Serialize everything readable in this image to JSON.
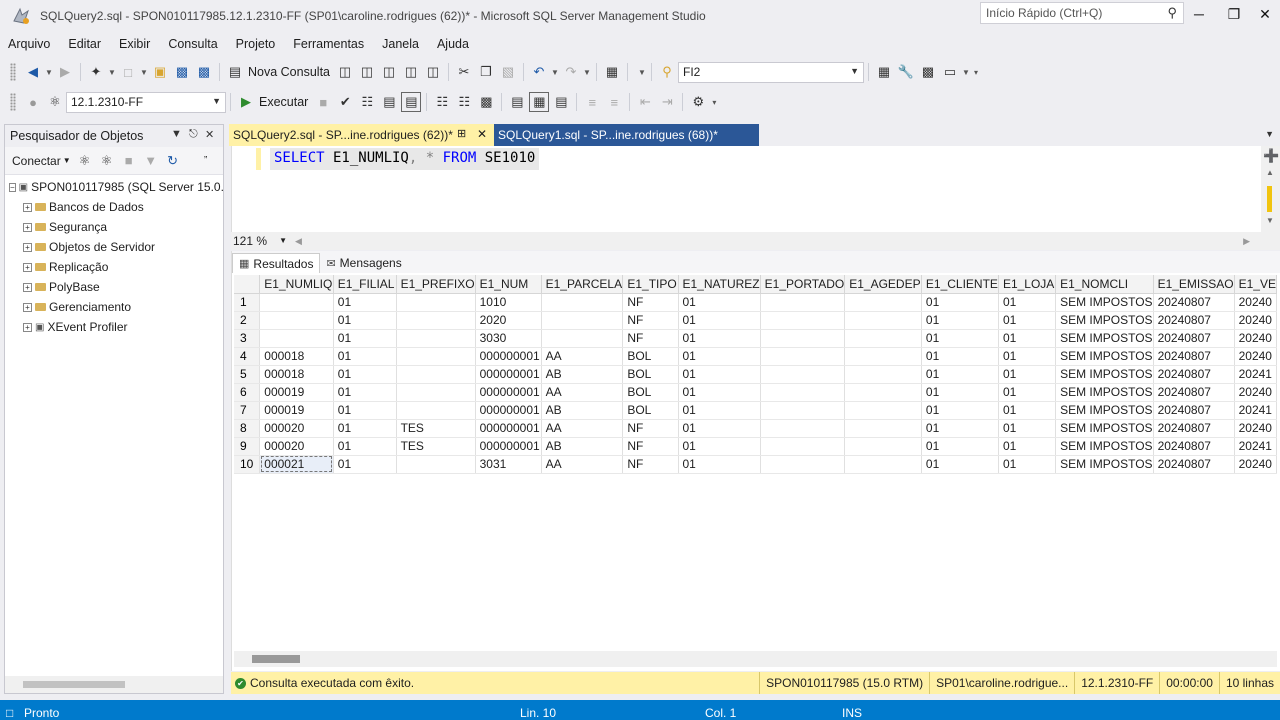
{
  "window": {
    "title": "SQLQuery2.sql - SPON010117985.12.1.2310-FF (SP01\\caroline.rodrigues (62))* - Microsoft SQL Server Management Studio",
    "quick_launch_placeholder": "Início Rápido (Ctrl+Q)"
  },
  "menu": [
    "Arquivo",
    "Editar",
    "Exibir",
    "Consulta",
    "Projeto",
    "Ferramentas",
    "Janela",
    "Ajuda"
  ],
  "toolbar1": {
    "new_query": "Nova Consulta",
    "solution_combo": "FI2"
  },
  "toolbar2": {
    "database_combo": "12.1.2310-FF",
    "execute": "Executar"
  },
  "object_explorer": {
    "title": "Pesquisador de Objetos",
    "connect": "Conectar",
    "server": "SPON010117985 (SQL Server 15.0.",
    "nodes": [
      "Bancos de Dados",
      "Segurança",
      "Objetos de Servidor",
      "Replicação",
      "PolyBase",
      "Gerenciamento",
      "XEvent Profiler"
    ]
  },
  "tabs": {
    "active": "SQLQuery2.sql - SP...ine.rodrigues (62))*",
    "inactive": "SQLQuery1.sql - SP...ine.rodrigues (68))*"
  },
  "editor": {
    "kw1": "SELECT",
    "t1": " E1_NUMLIQ",
    "comma": ",",
    "star": " * ",
    "kw2": "FROM",
    "t2": " SE1010",
    "zoom": "121 %"
  },
  "results": {
    "tab_results": "Resultados",
    "tab_messages": "Mensagens",
    "columns": [
      "",
      "E1_NUMLIQ",
      "E1_FILIAL",
      "E1_PREFIXO",
      "E1_NUM",
      "E1_PARCELA",
      "E1_TIPO",
      "E1_NATUREZ",
      "E1_PORTADO",
      "E1_AGEDEP",
      "E1_CLIENTE",
      "E1_LOJA",
      "E1_NOMCLI",
      "E1_EMISSAO",
      "E1_VE"
    ],
    "rows": [
      [
        "1",
        "",
        "01",
        "",
        "1010",
        "",
        "NF",
        "01",
        "",
        "",
        "01",
        "01",
        "SEM IMPOSTOS",
        "20240807",
        "20240"
      ],
      [
        "2",
        "",
        "01",
        "",
        "2020",
        "",
        "NF",
        "01",
        "",
        "",
        "01",
        "01",
        "SEM IMPOSTOS",
        "20240807",
        "20240"
      ],
      [
        "3",
        "",
        "01",
        "",
        "3030",
        "",
        "NF",
        "01",
        "",
        "",
        "01",
        "01",
        "SEM IMPOSTOS",
        "20240807",
        "20240"
      ],
      [
        "4",
        "000018",
        "01",
        "",
        "000000001",
        "AA",
        "BOL",
        "01",
        "",
        "",
        "01",
        "01",
        "SEM IMPOSTOS",
        "20240807",
        "20240"
      ],
      [
        "5",
        "000018",
        "01",
        "",
        "000000001",
        "AB",
        "BOL",
        "01",
        "",
        "",
        "01",
        "01",
        "SEM IMPOSTOS",
        "20240807",
        "20241"
      ],
      [
        "6",
        "000019",
        "01",
        "",
        "000000001",
        "AA",
        "BOL",
        "01",
        "",
        "",
        "01",
        "01",
        "SEM IMPOSTOS",
        "20240807",
        "20240"
      ],
      [
        "7",
        "000019",
        "01",
        "",
        "000000001",
        "AB",
        "BOL",
        "01",
        "",
        "",
        "01",
        "01",
        "SEM IMPOSTOS",
        "20240807",
        "20241"
      ],
      [
        "8",
        "000020",
        "01",
        "TES",
        "000000001",
        "AA",
        "NF",
        "01",
        "",
        "",
        "01",
        "01",
        "SEM IMPOSTOS",
        "20240807",
        "20240"
      ],
      [
        "9",
        "000020",
        "01",
        "TES",
        "000000001",
        "AB",
        "NF",
        "01",
        "",
        "",
        "01",
        "01",
        "SEM IMPOSTOS",
        "20240807",
        "20241"
      ],
      [
        "10",
        "000021",
        "01",
        "",
        "3031",
        "AA",
        "NF",
        "01",
        "",
        "",
        "01",
        "01",
        "SEM IMPOSTOS",
        "20240807",
        "20240"
      ]
    ]
  },
  "query_status": {
    "message": "Consulta executada com êxito.",
    "server": "SPON010117985 (15.0 RTM)",
    "user": "SP01\\caroline.rodrigue...",
    "database": "12.1.2310-FF",
    "time": "00:00:00",
    "rows": "10 linhas"
  },
  "statusbar": {
    "state": "Pronto",
    "line": "Lin. 10",
    "col": "Col. 1",
    "mode": "INS"
  }
}
